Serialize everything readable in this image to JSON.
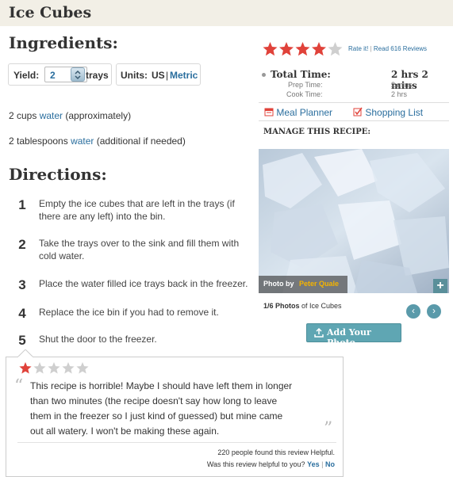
{
  "page_title": "Ice Cubes",
  "ingredients_heading": "Ingredients:",
  "yield": {
    "label": "Yield:",
    "value": "2",
    "unit": "trays"
  },
  "units": {
    "label": "Units:",
    "us": "US",
    "separator": "|",
    "metric": "Metric"
  },
  "ingredients": [
    {
      "qty": "2 cups",
      "item": "water",
      "note": "(approximately)"
    },
    {
      "qty": "2 tablespoons",
      "item": "water",
      "note": "(additional if needed)"
    }
  ],
  "directions_heading": "Directions:",
  "directions": [
    {
      "num": "1",
      "line1": "Empty the ice cubes that are left in the trays (if",
      "line2": "there are any left) into the bin."
    },
    {
      "num": "2",
      "line1": "Take the trays over to the sink and fill them with",
      "line2": "cold water."
    },
    {
      "num": "3",
      "line1": "Place the water filled ice trays back in the freezer.",
      "line2": ""
    },
    {
      "num": "4",
      "line1": "Replace the ice bin if you had to remove it.",
      "line2": ""
    },
    {
      "num": "5",
      "line1": "Shut the door to the freezer.",
      "line2": ""
    }
  ],
  "rating": {
    "stars": 4,
    "max": 5,
    "rate_it": "Rate it!",
    "separator": "|",
    "read_reviews": "Read 616 Reviews"
  },
  "times": {
    "total_label": "Total Time:",
    "total_value": "2 hrs 2 mins",
    "prep_label": "Prep Time:",
    "prep_value": "2 mins",
    "cook_label": "Cook Time:",
    "cook_value": "2 hrs"
  },
  "actions": {
    "meal_planner": "Meal Planner",
    "shopping_list": "Shopping List"
  },
  "manage_heading": "MANAGE THIS RECIPE:",
  "photo": {
    "credit_prefix": "Photo by",
    "credit_name": "Peter Quale",
    "counter": "1/6 Photos",
    "counter_suffix": "of Ice Cubes",
    "prev": "‹",
    "next": "›",
    "add_photo": "Add Your Photo",
    "plus": "+"
  },
  "review": {
    "stars": 1,
    "max": 5,
    "open_quote": "“",
    "close_quote": "”",
    "lines": [
      "This recipe is horrible! Maybe I should have left them in longer",
      "than two minutes (the recipe doesn't say how long to leave",
      "them in the freezer so I just kind of guessed) but mine came",
      "out all watery. I won't be making these again."
    ],
    "helpful_count": "220 people found this review Helpful.",
    "helpful_question": "Was this review helpful to you?",
    "yes": "Yes",
    "separator": "|",
    "no": "No"
  },
  "colors": {
    "star_on": "#e0423a",
    "star_off": "#cfcfcf",
    "link": "#2a6e9e",
    "title_bar": "#f2efe6",
    "add_photo_btn": "#5fa6b3"
  }
}
